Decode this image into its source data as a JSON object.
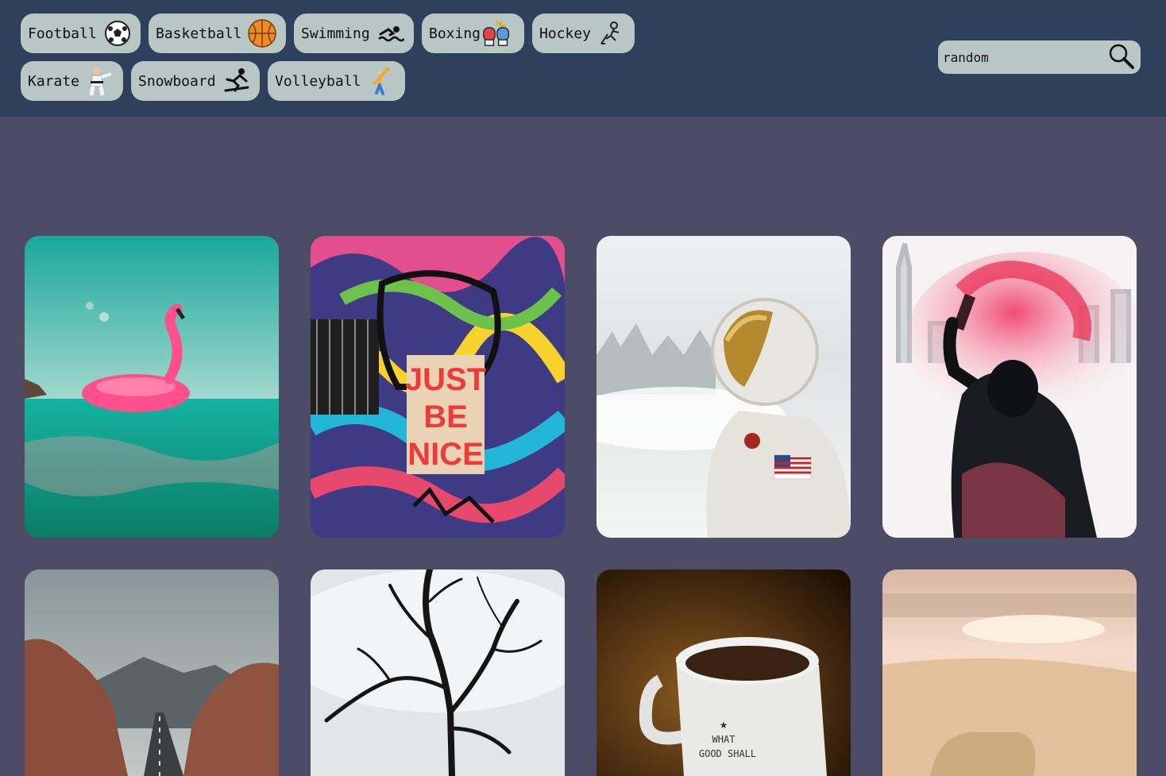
{
  "categories": [
    {
      "label": "Football",
      "icon": "soccer-ball-icon"
    },
    {
      "label": "Basketball",
      "icon": "basketball-icon"
    },
    {
      "label": "Swimming",
      "icon": "swimmer-icon"
    },
    {
      "label": "Boxing",
      "icon": "boxing-gloves-icon"
    },
    {
      "label": "Hockey",
      "icon": "hockey-player-icon"
    },
    {
      "label": "Karate",
      "icon": "karate-figure-icon"
    },
    {
      "label": "Snowboard",
      "icon": "snowboarder-icon"
    },
    {
      "label": "Volleyball",
      "icon": "volleyball-player-icon"
    }
  ],
  "search": {
    "value": "random",
    "icon": "magnifier-icon"
  },
  "colors": {
    "header": "#2e405b",
    "background": "#4d4c67",
    "chip": "#b8c6c4"
  },
  "gallery": {
    "row1": [
      {
        "subject": "flamingo-float-photo"
      },
      {
        "subject": "graffiti-wall-photo",
        "sign_lines": [
          "JUST",
          "BE",
          "NICE"
        ]
      },
      {
        "subject": "astronaut-snow-photo"
      },
      {
        "subject": "smoke-flare-photo"
      }
    ],
    "row2": [
      {
        "subject": "canyon-road-photo"
      },
      {
        "subject": "bare-tree-photo"
      },
      {
        "subject": "coffee-mug-photo",
        "mug_lines": [
          "WHAT",
          "GOOD SHALL"
        ]
      },
      {
        "subject": "beach-sunset-photo"
      }
    ]
  }
}
